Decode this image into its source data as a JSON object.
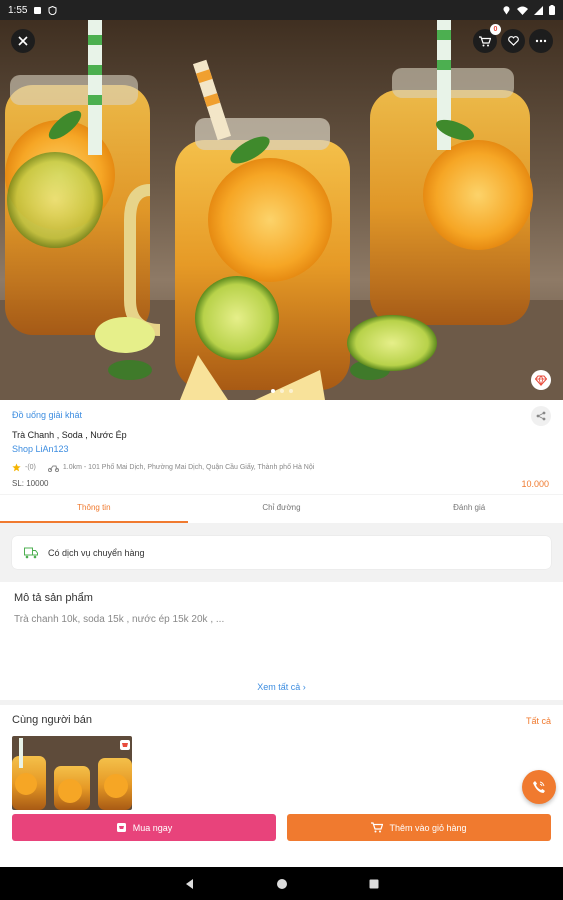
{
  "status_bar": {
    "time": "1:55"
  },
  "hero": {
    "cart_count": "0",
    "slide_count": 3,
    "active_slide": 0
  },
  "product": {
    "category": "Đồ uống giải khát",
    "name": "Trà Chanh , Soda , Nước Ép",
    "shop": "Shop LiAn123",
    "rating": "-(0)",
    "distance_address": "1.0km - 101 Phố Mai Dịch, Phường Mai Dịch, Quận Cầu Giấy, Thành phố Hà Nội",
    "quantity": "SL: 10000",
    "price": "10.000"
  },
  "tabs": [
    {
      "label": "Thông tin",
      "active": true
    },
    {
      "label": "Chỉ đường",
      "active": false
    },
    {
      "label": "Đánh giá",
      "active": false
    }
  ],
  "delivery": {
    "text": "Có dịch vụ chuyển hàng"
  },
  "description": {
    "title": "Mô tả sản phẩm",
    "text": "Trà chanh 10k, soda 15k , nước ép 15k 20k , ...",
    "see_all": "Xem tất cả ›"
  },
  "same_seller": {
    "title": "Cùng người bán",
    "all_label": "Tất cả"
  },
  "actions": {
    "buy_now": "Mua ngay",
    "add_to_cart": "Thêm vào giỏ hàng"
  },
  "colors": {
    "accent": "#f07a2f",
    "buy": "#e8437b",
    "link": "#3d8de0"
  },
  "icons": {
    "close": "close-icon",
    "cart": "cart-icon",
    "favorite": "heart-icon",
    "more": "more-icon",
    "share": "share-icon",
    "gem": "gem-icon",
    "star": "star-icon",
    "delivery": "truck-icon",
    "call": "phone-icon"
  }
}
